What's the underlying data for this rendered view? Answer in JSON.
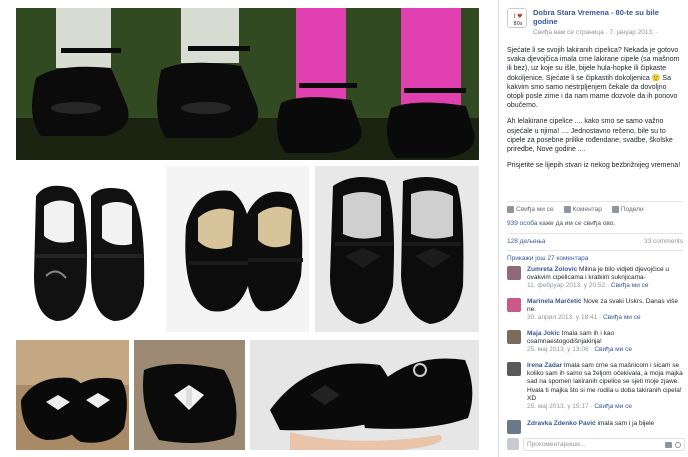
{
  "page": {
    "name": "Dobra Stara Vremena - 80-te su bile godine",
    "meta": "Свиђа вам се страница · 7. јануар 2013. ·"
  },
  "post": {
    "paragraphs": [
      "Sjećate li se svojih lakiranih cipelica? Nekada je gotovo svaka djevojčica imala crne lakirane cipele (sa mašnom ili bez), uz koje su išle, bijele hula-hopke ili čipkaste dokoljenice. Sjećate li se čipkastih dokoljenica 🙂 Sa kakvim smo samo nestrpljenjem čekale da dovoljno otopli posle zime i da nam mame dozvole da ih ponovo obučemo.",
      "Ah lelakirane cipelice .... kako smo se samo važno osjećale u njima! .... Jednostavno rečeno, bile su to cipele za posebne prilike rođendane, svadbe, školske priredbe, Nove godine ....",
      "Prisjetite se lijepih stvari iz nekog bezbrižnijeg vremena!"
    ]
  },
  "actions": {
    "like": "Свиђа ми се",
    "comment": "Коментар",
    "share": "Подели"
  },
  "stats": {
    "likes_count": "939 особа",
    "likes_suffix": " каже да им се свиђа ово.",
    "shares": "128 дељења",
    "comments": "33 comments",
    "show_more": "Прикажи још 27 коментара"
  },
  "comments": [
    {
      "name": "Zumreta Zolovic",
      "text": " Milina je bilo vidjeti djevojčice u ovakvim cipelicama i kratkim suknjicama-",
      "time": "11. фебруар 2013. у 20:52 · ",
      "like": "Свиђа ми се",
      "color": "#8e6a7a"
    },
    {
      "name": "Marinela Marčetić",
      "text": " Nove za svaki Uskrs. Danas više ne.",
      "time": "30. април 2013. у 18:41 · ",
      "like": "Свиђа ми се",
      "color": "#c85a8a"
    },
    {
      "name": "Maja Jokic",
      "text": " Imala sam ih i kao osamnaestogodišnjakinja!",
      "time": "25. мај 2013. у 13:06 · ",
      "like": "Свиђа ми се",
      "color": "#7a6b5a"
    },
    {
      "name": "Irena Zadar",
      "text": " Imala sam crne sa mašnicom i sicam se koliko sam ih samo sa željom očekivala, a moja majka sad na spomen lakiranih cipelice se sjeti moje zjawe. Hvala ti majka što si me rodila u doba lakiranih cipela! XD",
      "time": "25. мај 2013. у 15:17 · ",
      "like": "Свиђа ми се",
      "color": "#5a5a5a"
    },
    {
      "name": "Zdravka Zdenko Pavić",
      "text": " imala sam i ja bijele",
      "time": "",
      "like": "",
      "color": "#6a7a8a"
    }
  ],
  "comment_box": {
    "placeholder": "Прокоментариши..."
  },
  "colors": {
    "link": "#365899",
    "gray": "#90949c",
    "border": "#dddfe2"
  }
}
